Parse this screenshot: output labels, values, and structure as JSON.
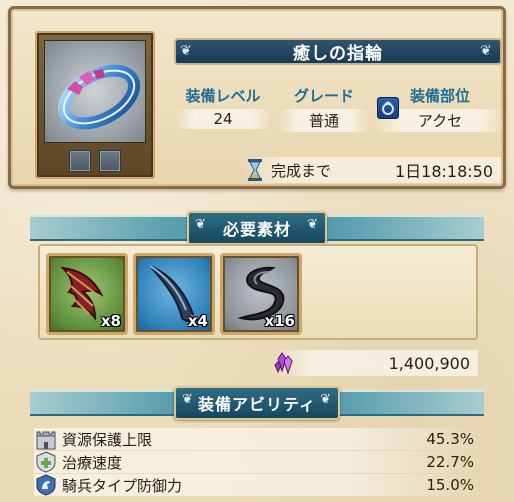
{
  "item": {
    "name": "癒しの指輪",
    "level_label": "装備レベル",
    "level_value": "24",
    "grade_label": "グレード",
    "grade_value": "普通",
    "part_label": "装備部位",
    "part_value": "アクセ",
    "timer_label": "完成まで",
    "timer_value": "1日18:18:50"
  },
  "materials": {
    "title": "必要素材",
    "items": [
      {
        "icon": "red-wing-icon",
        "count": "x8"
      },
      {
        "icon": "blue-claw-icon",
        "count": "x4"
      },
      {
        "icon": "gray-horn-icon",
        "count": "x16"
      }
    ],
    "cost_icon": "crystal-icon",
    "cost_value": "1,400,900"
  },
  "abilities": {
    "title": "装備アビリティ",
    "items": [
      {
        "icon": "castle-icon",
        "name": "資源保護上限",
        "value": "45.3%"
      },
      {
        "icon": "heal-cross-icon",
        "name": "治療速度",
        "value": "22.7%"
      },
      {
        "icon": "cavalry-shield-icon",
        "name": "騎兵タイプ防御力",
        "value": "15.0%"
      }
    ]
  },
  "colors": {
    "header_navy": "#183b55",
    "label_blue": "#1f6e95",
    "section_teal": "#4a8fa3",
    "parchment": "#efe3c6"
  }
}
